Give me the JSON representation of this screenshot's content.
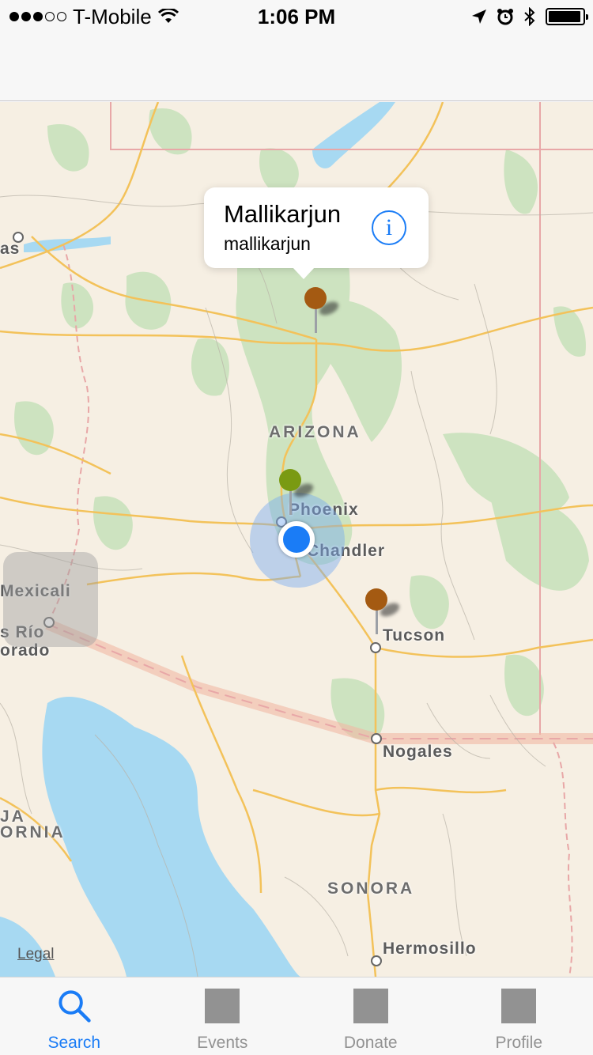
{
  "status_bar": {
    "carrier": "T-Mobile",
    "time": "1:06 PM",
    "signal_bars_filled": 3,
    "signal_bars_total": 5,
    "battery_level": 0.95,
    "icons": [
      "wifi-icon",
      "location-arrow-icon",
      "alarm-icon",
      "bluetooth-icon",
      "battery-icon"
    ]
  },
  "map": {
    "labels": {
      "arizona": "ARIZONA",
      "phoenix": "Phoenix",
      "chandler": "Chandler",
      "tucson": "Tucson",
      "nogales": "Nogales",
      "mexicali": "Mexicali",
      "rio": "s Río",
      "orado": "orado",
      "ja": "JA",
      "ornia": "ORNIA",
      "sonora": "SONORA",
      "hermosillo": "Hermosillo",
      "as": "as"
    },
    "callout": {
      "title": "Mallikarjun",
      "subtitle": "mallikarjun",
      "info_glyph": "i"
    },
    "pins": [
      {
        "name": "pin-flagstaff",
        "color": "#a45a12"
      },
      {
        "name": "pin-phoenix",
        "color": "#7a9a12"
      },
      {
        "name": "pin-tucson",
        "color": "#a45a12"
      }
    ],
    "legal": "Legal",
    "colors": {
      "land": "#f6efe3",
      "water": "#a7d9f2",
      "forest": "#cde3c0",
      "road": "#f3c25a",
      "highway": "#f2b8a8",
      "accent": "#1a7cf6"
    }
  },
  "tabbar": {
    "tabs": [
      {
        "label": "Search",
        "icon": "search-icon",
        "active": true
      },
      {
        "label": "Events",
        "icon": "placeholder-square-icon",
        "active": false
      },
      {
        "label": "Donate",
        "icon": "placeholder-square-icon",
        "active": false
      },
      {
        "label": "Profile",
        "icon": "placeholder-square-icon",
        "active": false
      }
    ]
  }
}
